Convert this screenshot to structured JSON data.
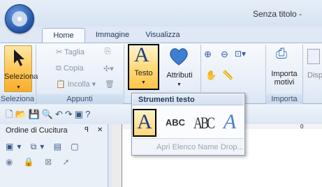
{
  "window": {
    "title": "Senza titolo -"
  },
  "tabs": [
    {
      "label": "Home"
    },
    {
      "label": "Immagine"
    },
    {
      "label": "Visualizza"
    }
  ],
  "ribbon": {
    "seleziona": {
      "label": "Seleziona",
      "group": "Seleziona"
    },
    "appunti": {
      "taglia": "Taglia",
      "copia": "Copia",
      "incolla": "Incolla",
      "group": "Appunti"
    },
    "testo": {
      "label": "Testo"
    },
    "attributi": {
      "label": "Attributi"
    },
    "importa": {
      "label1": "Importa",
      "label2": "motivi",
      "group": "Importa"
    },
    "disp": {
      "label": "Disp"
    }
  },
  "panel": {
    "title": "Ordine di Cucitura",
    "pin": "ꟼ",
    "close": "✕"
  },
  "ruler": {
    "marker": "0"
  },
  "dropdown": {
    "title": "Strumenti testo",
    "items": [
      {
        "glyph": "A"
      },
      {
        "glyph": "ABC"
      },
      {
        "glyph": "ABC"
      },
      {
        "glyph": "A"
      }
    ],
    "footer": "Apri Elenco Name Drop..."
  },
  "colors": {
    "accent": "#ffc85a",
    "ribbon": "#e7eef8",
    "frame": "#9eb6d4"
  }
}
